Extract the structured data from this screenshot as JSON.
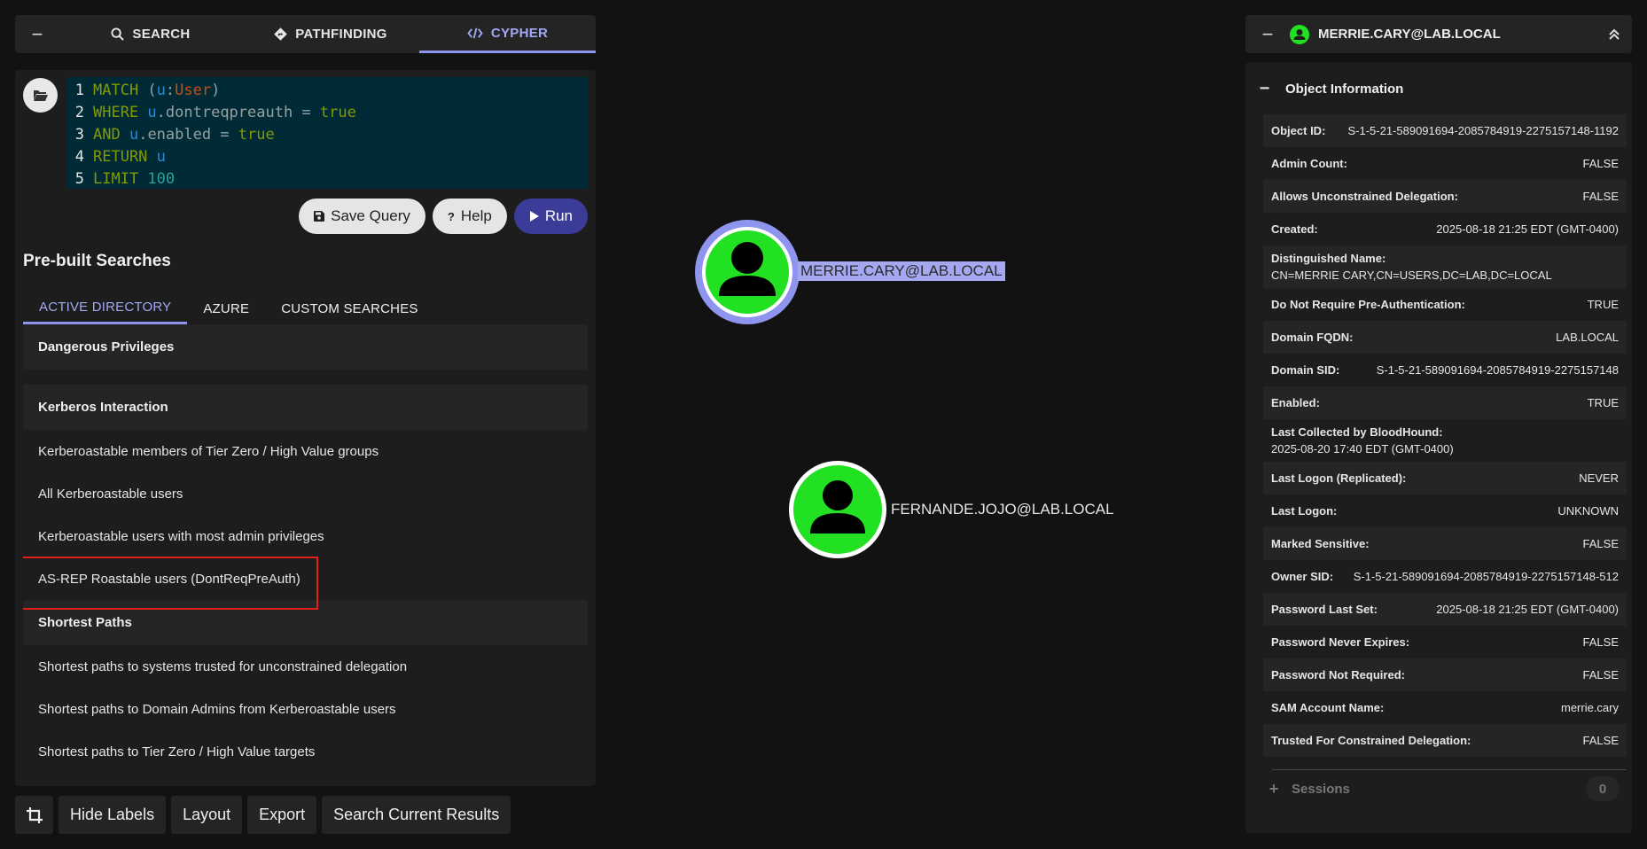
{
  "nav": {
    "tabs": [
      {
        "label": "SEARCH",
        "icon": "search-icon"
      },
      {
        "label": "PATHFINDING",
        "icon": "route-icon"
      },
      {
        "label": "CYPHER",
        "icon": "code-icon"
      }
    ]
  },
  "editor": {
    "lines": [
      {
        "n": "1"
      },
      {
        "n": "2"
      },
      {
        "n": "3"
      },
      {
        "n": "4"
      },
      {
        "n": "5"
      }
    ],
    "tokens": {
      "l1_a": "MATCH ",
      "l1_b": "(",
      "l1_c": "u",
      "l1_d": ":",
      "l1_e": "User",
      "l1_f": ")",
      "l2_a": "WHERE ",
      "l2_b": "u",
      "l2_c": ".dontreqpreauth = ",
      "l2_d": "true",
      "l3_a": "AND ",
      "l3_b": "u",
      "l3_c": ".enabled = ",
      "l3_d": "true",
      "l4_a": "RETURN ",
      "l4_b": "u",
      "l5_a": "LIMIT ",
      "l5_b": "100"
    }
  },
  "buttons": {
    "save": "Save Query",
    "help": "Help",
    "run": "Run"
  },
  "prebuilt": {
    "title": "Pre-built Searches",
    "tabs": [
      "ACTIVE DIRECTORY",
      "AZURE",
      "CUSTOM SEARCHES"
    ],
    "groups": {
      "dangerous": "Dangerous Privileges",
      "kerberos": "Kerberos Interaction",
      "shortest": "Shortest Paths"
    },
    "kerberos_items": [
      "Kerberoastable members of Tier Zero / High Value groups",
      "All Kerberoastable users",
      "Kerberoastable users with most admin privileges",
      "AS-REP Roastable users (DontReqPreAuth)"
    ],
    "shortest_items": [
      "Shortest paths to systems trusted for unconstrained delegation",
      "Shortest paths to Domain Admins from Kerberoastable users",
      "Shortest paths to Tier Zero / High Value targets"
    ]
  },
  "toolbar": {
    "hide_labels": "Hide Labels",
    "layout": "Layout",
    "export": "Export",
    "search_results": "Search Current Results"
  },
  "graph": {
    "nodes": [
      {
        "label": "MERRIE.CARY@LAB.LOCAL",
        "selected": true
      },
      {
        "label": "FERNANDE.JOJO@LAB.LOCAL",
        "selected": false
      }
    ],
    "colors": {
      "node_fill": "#22e022",
      "selected_ring": "#8f95ee"
    }
  },
  "entity": {
    "title": "MERRIE.CARY@LAB.LOCAL",
    "section": "Object Information",
    "props": [
      {
        "k": "Object ID:",
        "v": "S-1-5-21-589091694-2085784919-2275157148-1192"
      },
      {
        "k": "Admin Count:",
        "v": "FALSE"
      },
      {
        "k": "Allows Unconstrained Delegation:",
        "v": "FALSE"
      },
      {
        "k": "Created:",
        "v": "2025-08-18 21:25 EDT (GMT-0400)"
      },
      {
        "k": "Distinguished Name:",
        "v": "CN=MERRIE CARY,CN=USERS,DC=LAB,DC=LOCAL"
      },
      {
        "k": "Do Not Require Pre-Authentication:",
        "v": "TRUE"
      },
      {
        "k": "Domain FQDN:",
        "v": "LAB.LOCAL"
      },
      {
        "k": "Domain SID:",
        "v": "S-1-5-21-589091694-2085784919-2275157148"
      },
      {
        "k": "Enabled:",
        "v": "TRUE"
      },
      {
        "k": "Last Collected by BloodHound:",
        "v": "2025-08-20 17:40 EDT (GMT-0400)"
      },
      {
        "k": "Last Logon (Replicated):",
        "v": "NEVER"
      },
      {
        "k": "Last Logon:",
        "v": "UNKNOWN"
      },
      {
        "k": "Marked Sensitive:",
        "v": "FALSE"
      },
      {
        "k": "Owner SID:",
        "v": "S-1-5-21-589091694-2085784919-2275157148-512"
      },
      {
        "k": "Password Last Set:",
        "v": "2025-08-18 21:25 EDT (GMT-0400)"
      },
      {
        "k": "Password Never Expires:",
        "v": "FALSE"
      },
      {
        "k": "Password Not Required:",
        "v": "FALSE"
      },
      {
        "k": "SAM Account Name:",
        "v": "merrie.cary"
      },
      {
        "k": "Trusted For Constrained Delegation:",
        "v": "FALSE"
      }
    ],
    "sessions": {
      "label": "Sessions",
      "count": "0"
    }
  }
}
